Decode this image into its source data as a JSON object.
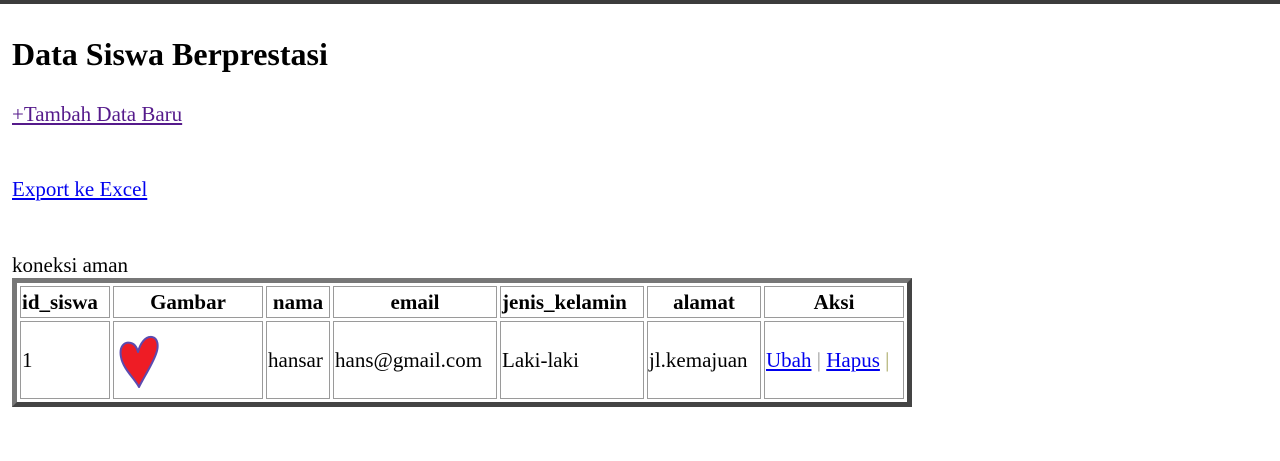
{
  "page": {
    "title": "Data Siswa Berprestasi",
    "add_link": "+Tambah Data Baru",
    "export_link": "Export ke Excel",
    "status_text": "koneksi aman"
  },
  "table": {
    "headers": [
      "id_siswa",
      "Gambar",
      "nama",
      "email",
      "jenis_kelamin",
      "alamat",
      "Aksi"
    ],
    "rows": [
      {
        "id_siswa": "1",
        "gambar_icon": "red-heart-image",
        "nama": "hansar",
        "email": "hans@gmail.com",
        "jenis_kelamin": "Laki-laki",
        "alamat": "jl.kemajuan",
        "aksi": {
          "edit_label": "Ubah",
          "separator": "|",
          "delete_label": "Hapus",
          "trailing_separator": "|"
        }
      }
    ]
  },
  "colors": {
    "heart_fill": "#ee1c25",
    "heart_outline": "#5b4bb0",
    "visited_link": "#551a8b",
    "link": "#0000ee"
  }
}
